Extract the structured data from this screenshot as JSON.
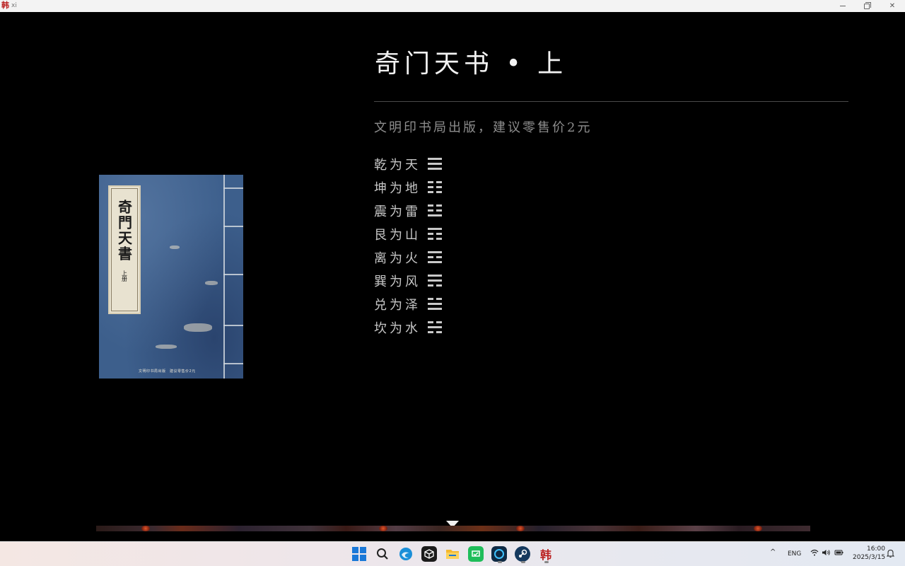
{
  "window": {
    "title": "xi",
    "app_glyph": "韩",
    "controls": {
      "minimize": "minimize-icon",
      "maximize": "maximize-icon",
      "close": "close-icon"
    }
  },
  "page": {
    "title": "奇门天书 • 上",
    "publisher": "文明印书局出版，建议零售价2元",
    "hexagrams": [
      {
        "name": "乾为天",
        "lines": [
          1,
          1,
          1
        ]
      },
      {
        "name": "坤为地",
        "lines": [
          0,
          0,
          0
        ]
      },
      {
        "name": "震为雷",
        "lines": [
          0,
          0,
          1
        ]
      },
      {
        "name": "艮为山",
        "lines": [
          1,
          0,
          0
        ]
      },
      {
        "name": "离为火",
        "lines": [
          1,
          0,
          1
        ]
      },
      {
        "name": "巽为风",
        "lines": [
          1,
          1,
          0
        ]
      },
      {
        "name": "兑为泽",
        "lines": [
          0,
          1,
          1
        ]
      },
      {
        "name": "坎为水",
        "lines": [
          0,
          1,
          0
        ]
      }
    ]
  },
  "book_cover": {
    "title_vertical": "奇門天書",
    "volume": "上册",
    "bottom_text": "文明印书局出版　建议零售价2元"
  },
  "taskbar": {
    "icons": [
      "windows-start-icon",
      "search-icon",
      "edge-browser-icon",
      "app-cube-icon",
      "file-explorer-icon",
      "wechat-icon",
      "app-ring-icon",
      "steam-icon",
      "game-app-icon"
    ],
    "language": "ENG",
    "time": "16:00",
    "date": "2025/3/15"
  }
}
